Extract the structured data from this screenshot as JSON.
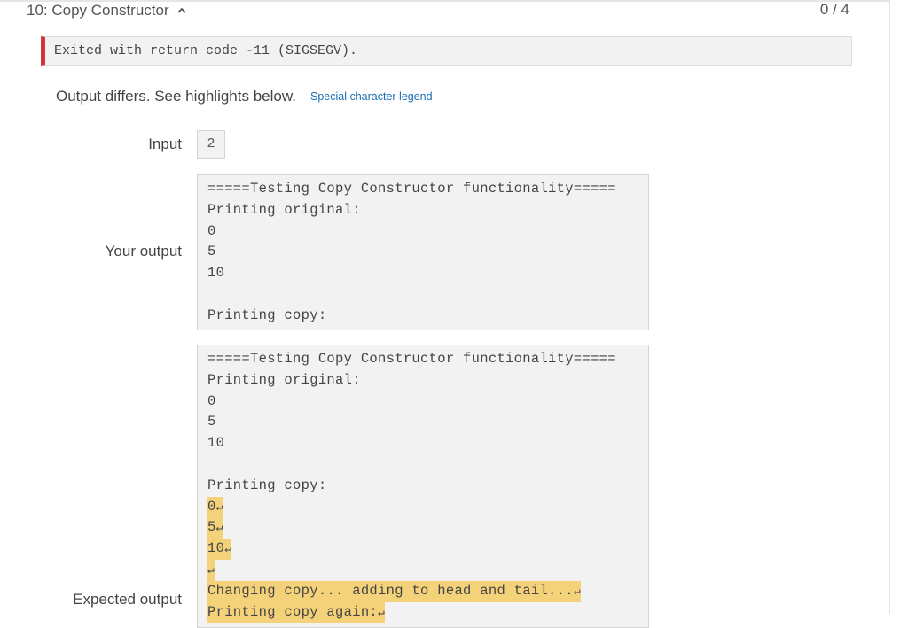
{
  "test": {
    "title": "10: Copy Constructor",
    "score": "0 / 4"
  },
  "error": {
    "message": "Exited with return code -11 (SIGSEGV)."
  },
  "diff": {
    "message": "Output differs. See highlights below.",
    "legend_link": "Special character legend"
  },
  "labels": {
    "input": "Input",
    "your_output": "Your output",
    "expected_output": "Expected output"
  },
  "input_value": "2",
  "newline_symbol": "↵",
  "your_output_lines": [
    "=====Testing Copy Constructor functionality=====",
    "Printing original:",
    "0",
    "5",
    "10",
    "",
    "Printing copy:"
  ],
  "expected_output_lines": [
    {
      "text": "=====Testing Copy Constructor functionality=====",
      "highlight": false
    },
    {
      "text": "Printing original:",
      "highlight": false
    },
    {
      "text": "0",
      "highlight": false
    },
    {
      "text": "5",
      "highlight": false
    },
    {
      "text": "10",
      "highlight": false
    },
    {
      "text": "",
      "highlight": false
    },
    {
      "text": "Printing copy:",
      "highlight": false
    },
    {
      "text": "0",
      "highlight": true
    },
    {
      "text": "5",
      "highlight": true
    },
    {
      "text": "10",
      "highlight": true
    },
    {
      "text": "",
      "highlight": true
    },
    {
      "text": "Changing copy... adding to head and tail...",
      "highlight": true
    },
    {
      "text": "Printing copy again:",
      "highlight": true
    }
  ],
  "colors": {
    "error_accent": "#d9343a",
    "highlight": "#f3d27a",
    "link": "#1a6fb5"
  }
}
